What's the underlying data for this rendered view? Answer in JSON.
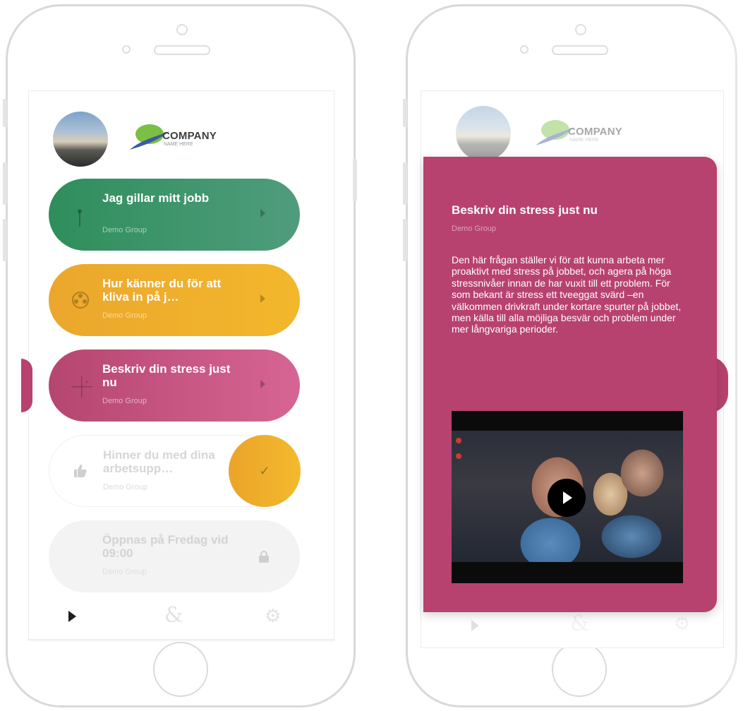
{
  "brand": {
    "name": "COMPANY",
    "tagline": "NAME HERE"
  },
  "items": [
    {
      "title": "Jag gillar mitt jobb",
      "group": "Demo Group",
      "icon": "pin-icon",
      "color": "#3a9466"
    },
    {
      "title": "Hur känner du för att kliva in på j…",
      "group": "Demo Group",
      "icon": "film-reel-icon",
      "color": "#f0b02c"
    },
    {
      "title": "Beskriv din stress just nu",
      "group": "Demo Group",
      "icon": "crosshair-icon",
      "color": "#c4507d"
    },
    {
      "title": "Hinner du med dina arbetsupp…",
      "group": "Demo Group",
      "icon": "thumbs-up-icon",
      "status_icon": "check-icon"
    },
    {
      "title": "Öppnas på Fredag vid 09:00",
      "group": "Demo Group",
      "icon": "lock-icon"
    }
  ],
  "tabbar": {
    "play": "play-icon",
    "ampersand": "&",
    "settings": "gear-icon"
  },
  "detail": {
    "title": "Beskriv din stress just nu",
    "group": "Demo Group",
    "body": "Den här frågan ställer vi för att kunna arbeta mer proaktivt med stress på jobbet, och agera på höga stressnivåer innan de har vuxit till ett problem. För som bekant är stress ett tveeggat svärd –en välkommen drivkraft under kortare spurter på jobbet, men källa till alla möjliga besvär och problem under mer långvariga perioder.",
    "video_icon": "play-button-icon",
    "color": "#b8426f"
  }
}
